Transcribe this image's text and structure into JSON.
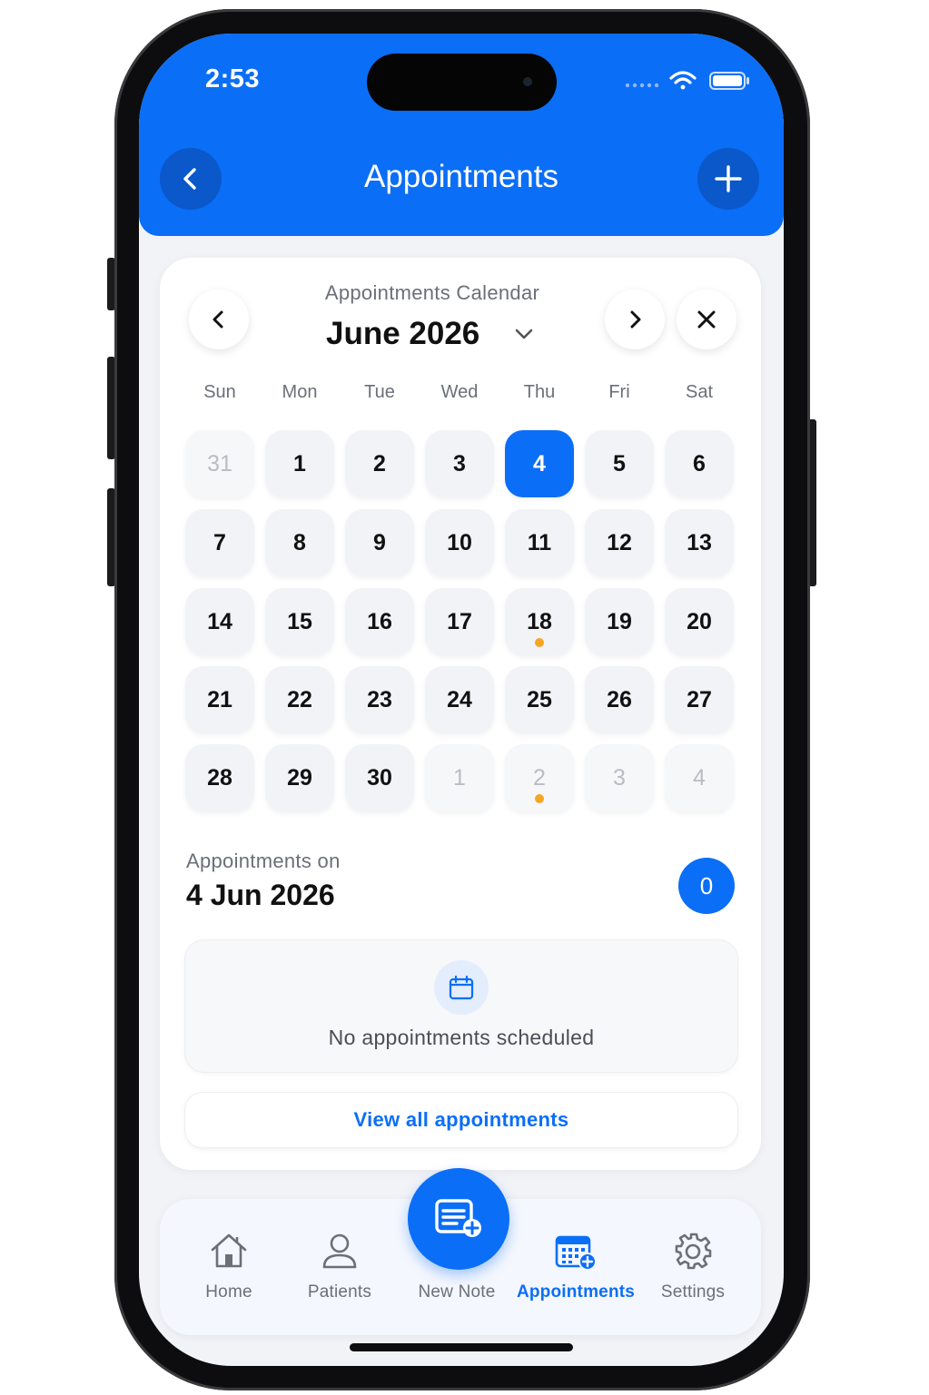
{
  "status_bar": {
    "time": "2:53",
    "icons": [
      "signal-icon",
      "wifi-icon",
      "battery-icon"
    ]
  },
  "header": {
    "title": "Appointments",
    "back_icon": "chevron-left-icon",
    "add_icon": "plus-icon",
    "background_color": "#0b6ef7"
  },
  "calendar": {
    "subtitle": "Appointments Calendar",
    "month_label": "June 2026",
    "prev_icon": "chevron-left-icon",
    "next_icon": "chevron-right-icon",
    "close_icon": "close-icon",
    "weekdays": [
      "Sun",
      "Mon",
      "Tue",
      "Wed",
      "Thu",
      "Fri",
      "Sat"
    ],
    "weeks": [
      [
        {
          "d": "31",
          "muted": true
        },
        {
          "d": "1"
        },
        {
          "d": "2"
        },
        {
          "d": "3"
        },
        {
          "d": "4",
          "selected": true
        },
        {
          "d": "5"
        },
        {
          "d": "6"
        }
      ],
      [
        {
          "d": "7"
        },
        {
          "d": "8"
        },
        {
          "d": "9"
        },
        {
          "d": "10"
        },
        {
          "d": "11"
        },
        {
          "d": "12"
        },
        {
          "d": "13"
        }
      ],
      [
        {
          "d": "14"
        },
        {
          "d": "15"
        },
        {
          "d": "16"
        },
        {
          "d": "17"
        },
        {
          "d": "18",
          "dot": true
        },
        {
          "d": "19"
        },
        {
          "d": "20"
        }
      ],
      [
        {
          "d": "21"
        },
        {
          "d": "22"
        },
        {
          "d": "23"
        },
        {
          "d": "24"
        },
        {
          "d": "25"
        },
        {
          "d": "26"
        },
        {
          "d": "27"
        }
      ],
      [
        {
          "d": "28"
        },
        {
          "d": "29"
        },
        {
          "d": "30"
        },
        {
          "d": "1",
          "muted": true
        },
        {
          "d": "2",
          "muted": true,
          "dot": true
        },
        {
          "d": "3",
          "muted": true
        },
        {
          "d": "4",
          "muted": true
        }
      ]
    ],
    "selected_color": "#0b6ef7",
    "dot_color": "#f5a623"
  },
  "appointments": {
    "label": "Appointments on",
    "date": "4 Jun 2026",
    "count": "0",
    "empty_icon": "calendar-icon",
    "empty_text": "No appointments scheduled",
    "view_all_label": "View all appointments"
  },
  "tabbar": {
    "items": [
      {
        "label": "Home",
        "icon": "home-icon"
      },
      {
        "label": "Patients",
        "icon": "user-icon"
      },
      {
        "label": "New Note",
        "icon": "new-note-icon"
      },
      {
        "label": "Appointments",
        "icon": "calendar-add-icon",
        "active": true
      },
      {
        "label": "Settings",
        "icon": "gear-icon"
      }
    ]
  }
}
